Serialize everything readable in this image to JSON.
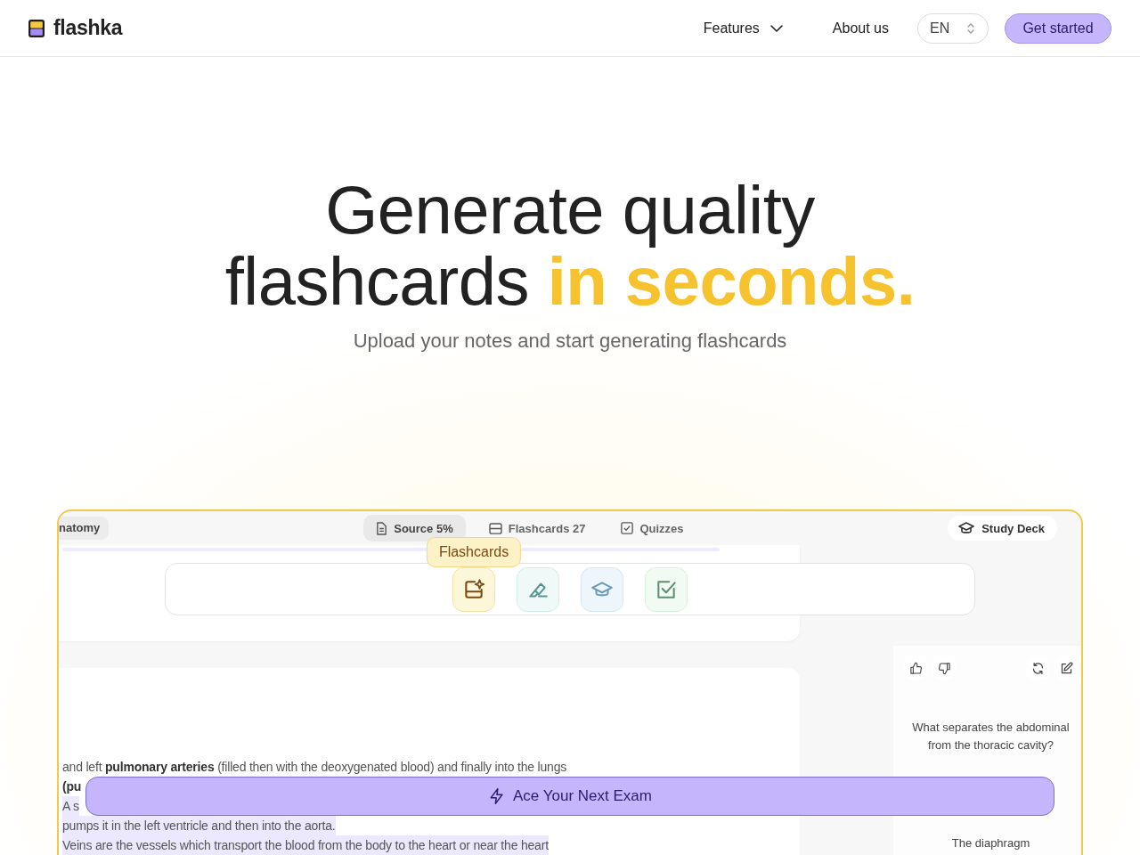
{
  "header": {
    "brand": "flashka",
    "nav": [
      {
        "label": "Features",
        "kind": "dropdown"
      },
      {
        "label": "About us",
        "kind": "link"
      }
    ],
    "language": "EN",
    "cta": "Get started"
  },
  "hero": {
    "title": "Generate quality flashcards **in seconds.**",
    "subtitle": "Upload your notes and start generating flashcards"
  },
  "preview": {
    "deck_tab": "natomy",
    "tabs": [
      {
        "label": "Source 5%",
        "kind": "source",
        "selected": true
      },
      {
        "label": "Flashcards 27",
        "kind": "flashcards",
        "selected": false
      },
      {
        "label": "Quizzes",
        "kind": "quizzes",
        "selected": false
      }
    ],
    "study_button": "Study Deck",
    "tools": [
      {
        "kind": "flashcards",
        "color": "#7a4a14",
        "tooltip": "Flashcards"
      },
      {
        "kind": "highlight",
        "color": "#5a9690"
      },
      {
        "kind": "study",
        "color": "#6a9bb8"
      },
      {
        "kind": "quiz",
        "color": "#5e8f6e"
      }
    ],
    "notes": [
      {
        "text": "and left **pulmonary arteries** (filled then with the deoxygenated blood) and finally into the lungs",
        "bold": false,
        "highlighted": false
      },
      {
        "text": "(pu",
        "bold": true,
        "highlighted": false
      },
      {
        "text": "A s",
        "bold": false,
        "highlighted": true
      },
      {
        "text": "pumps it in the left ventricle and then into the aorta.",
        "bold": false,
        "highlighted": true
      },
      {
        "text": "Veins are the vessels which transport the blood from the body to the heart or near the heart",
        "bold": false,
        "highlighted": true
      }
    ],
    "card": {
      "question": [
        "What separates the abdominal",
        "from the thoracic cavity?"
      ],
      "answer": "The diaphragm"
    },
    "cta": "Ace Your Next Exam"
  }
}
